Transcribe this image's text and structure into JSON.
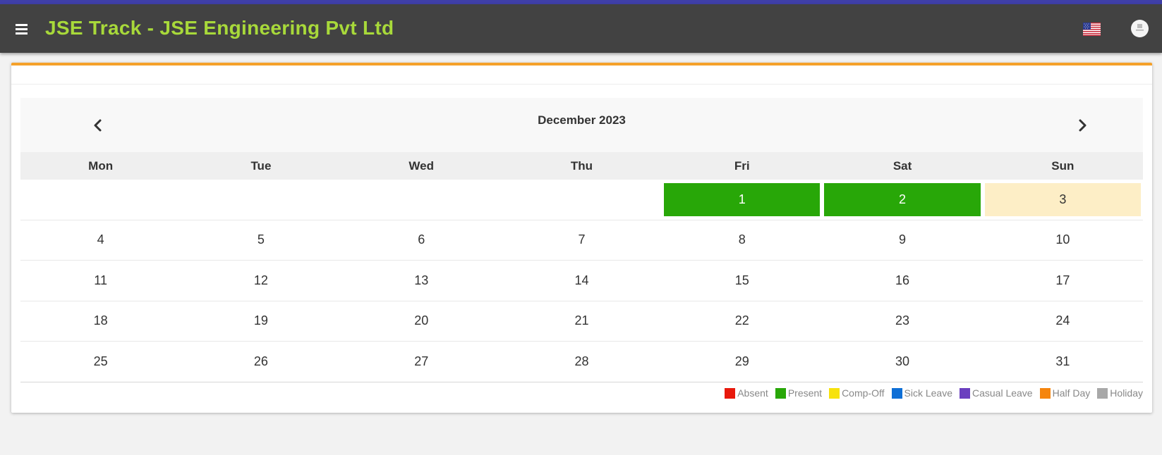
{
  "header": {
    "title": "JSE Track - JSE Engineering Pvt Ltd"
  },
  "calendar": {
    "month_title": "December 2023",
    "weekdays": [
      "Mon",
      "Tue",
      "Wed",
      "Thu",
      "Fri",
      "Sat",
      "Sun"
    ],
    "weeks": [
      [
        {
          "d": ""
        },
        {
          "d": ""
        },
        {
          "d": ""
        },
        {
          "d": ""
        },
        {
          "d": "1",
          "status": "present"
        },
        {
          "d": "2",
          "status": "present"
        },
        {
          "d": "3",
          "status": "holiday-soft"
        }
      ],
      [
        {
          "d": "4"
        },
        {
          "d": "5"
        },
        {
          "d": "6"
        },
        {
          "d": "7"
        },
        {
          "d": "8"
        },
        {
          "d": "9"
        },
        {
          "d": "10"
        }
      ],
      [
        {
          "d": "11"
        },
        {
          "d": "12"
        },
        {
          "d": "13"
        },
        {
          "d": "14"
        },
        {
          "d": "15"
        },
        {
          "d": "16"
        },
        {
          "d": "17"
        }
      ],
      [
        {
          "d": "18"
        },
        {
          "d": "19"
        },
        {
          "d": "20"
        },
        {
          "d": "21"
        },
        {
          "d": "22"
        },
        {
          "d": "23"
        },
        {
          "d": "24"
        }
      ],
      [
        {
          "d": "25"
        },
        {
          "d": "26"
        },
        {
          "d": "27"
        },
        {
          "d": "28"
        },
        {
          "d": "29"
        },
        {
          "d": "30"
        },
        {
          "d": "31"
        }
      ]
    ]
  },
  "legend": [
    {
      "label": "Absent",
      "color": "#e8190c"
    },
    {
      "label": "Present",
      "color": "#28a708"
    },
    {
      "label": "Comp-Off",
      "color": "#f7e20c"
    },
    {
      "label": "Sick Leave",
      "color": "#0f6fd6"
    },
    {
      "label": "Casual Leave",
      "color": "#6a3fbf"
    },
    {
      "label": "Half Day",
      "color": "#f5850e"
    },
    {
      "label": "Holiday",
      "color": "#a8a8a8"
    }
  ],
  "colors": {
    "navbar": "#424242",
    "title": "#a8d93a",
    "accent": "#f5a12a",
    "present": "#28a708",
    "weekend_highlight": "#fdeec6"
  }
}
